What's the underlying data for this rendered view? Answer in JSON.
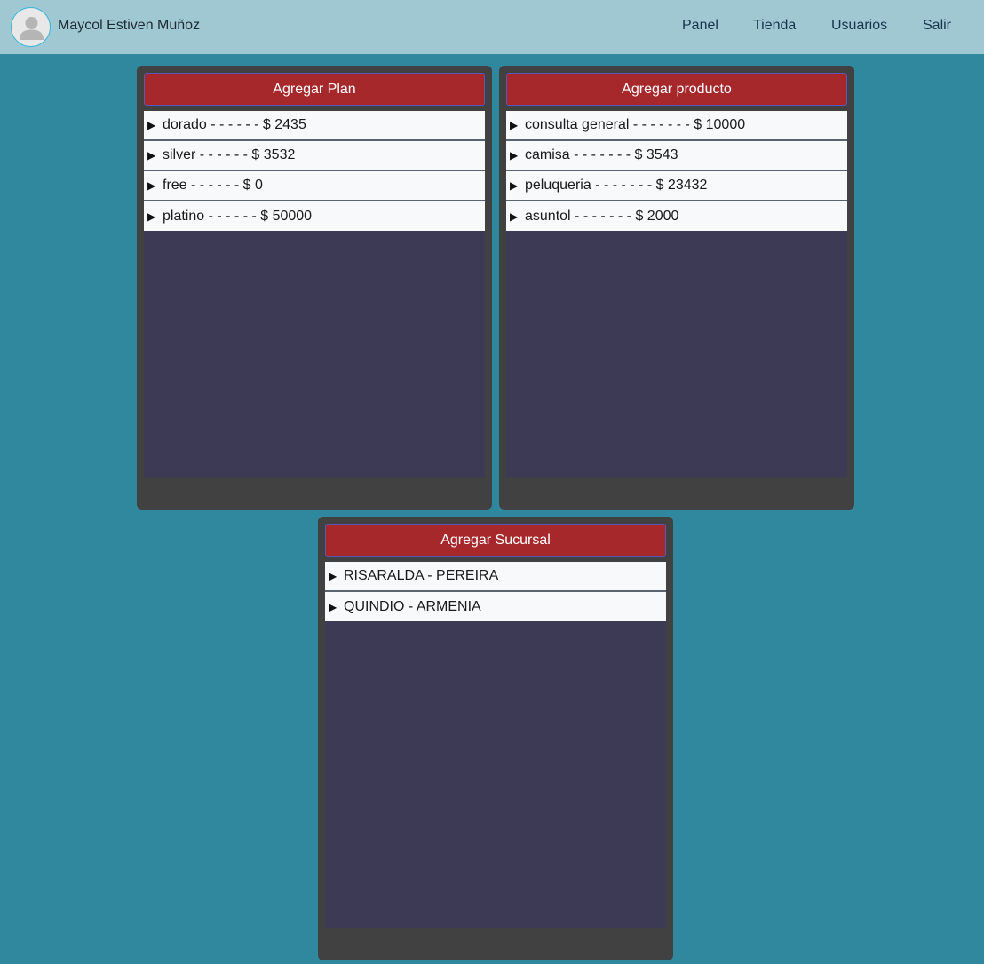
{
  "header": {
    "user_name": "Maycol Estiven Muñoz",
    "nav": [
      "Panel",
      "Tienda",
      "Usuarios",
      "Salir"
    ]
  },
  "panels": {
    "plans": {
      "button_label": "Agregar Plan",
      "items": [
        "dorado - - - - - - $ 2435",
        "silver - - - - - - $ 3532",
        "free - - - - - - $ 0",
        "platino - - - - - - $ 50000"
      ]
    },
    "products": {
      "button_label": "Agregar producto",
      "items": [
        "consulta general - - - - - - - $ 10000",
        "camisa - - - - - - - $ 3543",
        "peluqueria - - - - - - - $ 23432",
        "asuntol - - - - - - - $ 2000"
      ]
    },
    "branches": {
      "button_label": "Agregar Sucursal",
      "items": [
        "RISARALDA - PEREIRA",
        "QUINDIO - ARMENIA"
      ]
    }
  },
  "icons": {
    "expand_marker": "▶",
    "avatar": "user-silhouette"
  },
  "colors": {
    "page_bg": "#2f889e",
    "navbar_bg": "#9fc8d3",
    "panel_bg": "#414141",
    "panel_inner_bg": "#3c3a55",
    "button_bg": "#a6282b"
  }
}
